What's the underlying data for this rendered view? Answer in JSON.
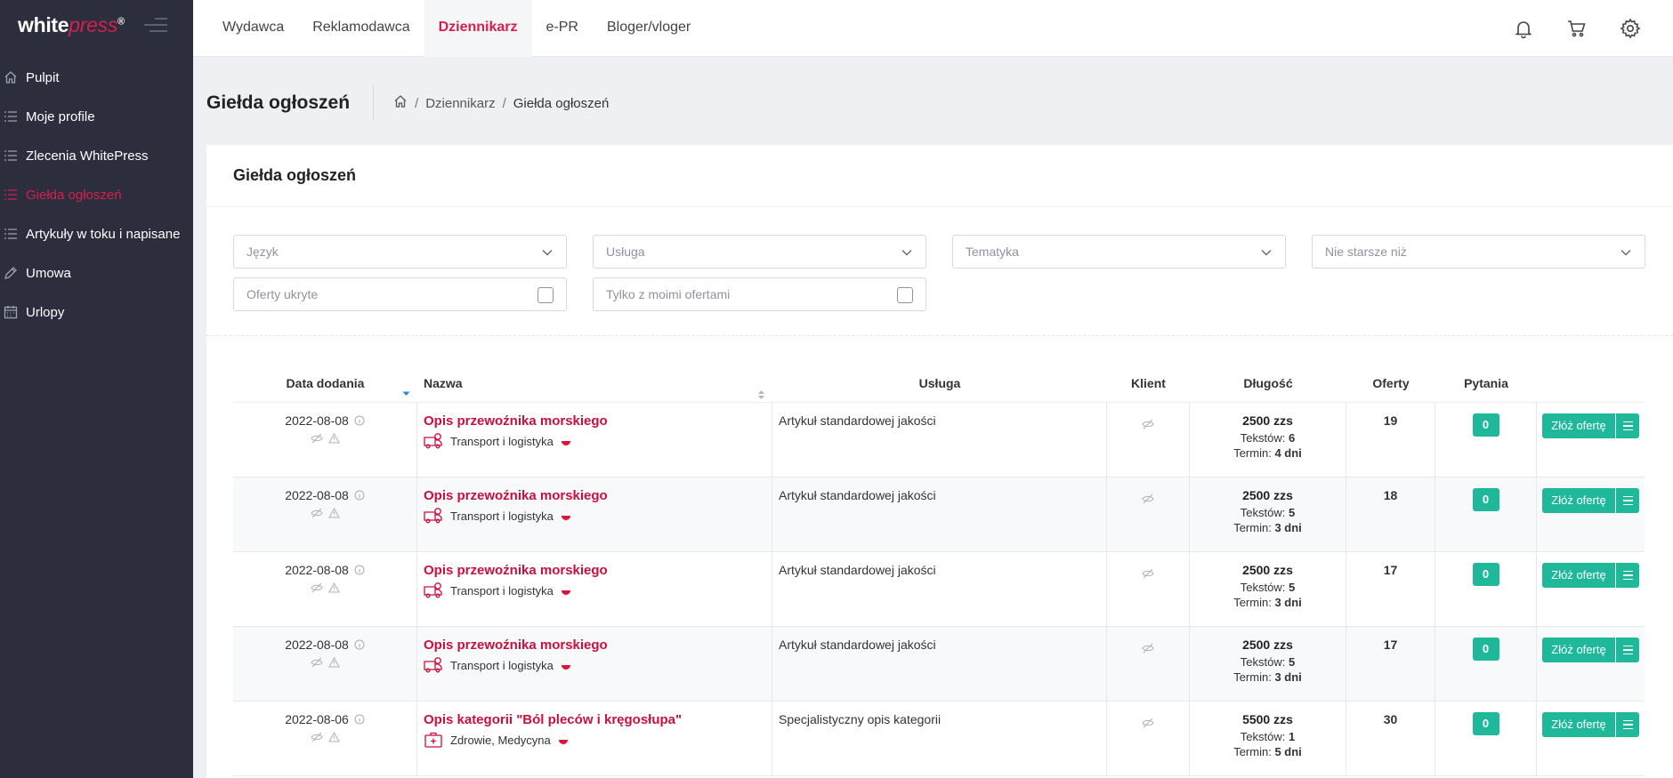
{
  "brand": {
    "name_a": "white",
    "name_b": "press",
    "reg": "®"
  },
  "sidebar": {
    "items": [
      {
        "label": "Pulpit",
        "icon": "home-icon",
        "active": false
      },
      {
        "label": "Moje profile",
        "icon": "list-icon",
        "active": false
      },
      {
        "label": "Zlecenia WhitePress",
        "icon": "list-icon",
        "active": false
      },
      {
        "label": "Giełda ogłoszeń",
        "icon": "list-icon",
        "active": true
      },
      {
        "label": "Artykuły w toku i napisane",
        "icon": "list-icon",
        "active": false
      },
      {
        "label": "Umowa",
        "icon": "pencil-icon",
        "active": false
      },
      {
        "label": "Urlopy",
        "icon": "calendar-icon",
        "active": false
      }
    ]
  },
  "topnav": {
    "tabs": [
      {
        "label": "Wydawca",
        "active": false
      },
      {
        "label": "Reklamodawca",
        "active": false
      },
      {
        "label": "Dziennikarz",
        "active": true
      },
      {
        "label": "e-PR",
        "active": false
      },
      {
        "label": "Bloger/vloger",
        "active": false
      }
    ],
    "icons": [
      "bell-icon",
      "cart-icon",
      "gear-icon"
    ]
  },
  "page": {
    "title": "Giełda ogłoszeń",
    "breadcrumb": {
      "parent": "Dziennikarz",
      "current": "Giełda ogłoszeń"
    }
  },
  "card": {
    "title": "Giełda ogłoszeń"
  },
  "filters": {
    "language": "Język",
    "service": "Usługa",
    "topic": "Tematyka",
    "not_older": "Nie starsze niż",
    "hidden_offers": "Oferty ukryte",
    "only_my_offers": "Tylko z moimi ofertami"
  },
  "table": {
    "headers": {
      "date": "Data dodania",
      "name": "Nazwa",
      "service": "Usługa",
      "client": "Klient",
      "length": "Długość",
      "offers": "Oferty",
      "questions": "Pytania"
    },
    "offer_button": "Złóż ofertę",
    "rows": [
      {
        "date": "2022-08-08",
        "title": "Opis przewoźnika morskiego",
        "category": "Transport i logistyka",
        "category_icon": "truck-icon",
        "service": "Artykuł standardowej jakości",
        "length": "2500 zzs",
        "texts_label": "Tekstów:",
        "texts": "6",
        "term_label": "Termin:",
        "term": "4 dni",
        "offers": "19",
        "questions": "0"
      },
      {
        "date": "2022-08-08",
        "title": "Opis przewoźnika morskiego",
        "category": "Transport i logistyka",
        "category_icon": "truck-icon",
        "service": "Artykuł standardowej jakości",
        "length": "2500 zzs",
        "texts_label": "Tekstów:",
        "texts": "5",
        "term_label": "Termin:",
        "term": "3 dni",
        "offers": "18",
        "questions": "0"
      },
      {
        "date": "2022-08-08",
        "title": "Opis przewoźnika morskiego",
        "category": "Transport i logistyka",
        "category_icon": "truck-icon",
        "service": "Artykuł standardowej jakości",
        "length": "2500 zzs",
        "texts_label": "Tekstów:",
        "texts": "5",
        "term_label": "Termin:",
        "term": "3 dni",
        "offers": "17",
        "questions": "0"
      },
      {
        "date": "2022-08-08",
        "title": "Opis przewoźnika morskiego",
        "category": "Transport i logistyka",
        "category_icon": "truck-icon",
        "service": "Artykuł standardowej jakości",
        "length": "2500 zzs",
        "texts_label": "Tekstów:",
        "texts": "5",
        "term_label": "Termin:",
        "term": "3 dni",
        "offers": "17",
        "questions": "0"
      },
      {
        "date": "2022-08-06",
        "title": "Opis kategorii \"Ból pleców i kręgosłupa\"",
        "category": "Zdrowie, Medycyna",
        "category_icon": "medical-kit-icon",
        "service": "Specjalistyczny opis kategorii",
        "length": "5500 zzs",
        "texts_label": "Tekstów:",
        "texts": "1",
        "term_label": "Termin:",
        "term": "5 dni",
        "offers": "30",
        "questions": "0"
      }
    ]
  },
  "colors": {
    "accent": "#d4204e",
    "teal": "#1fb89a",
    "sidebar_bg": "#2c2e3e"
  }
}
